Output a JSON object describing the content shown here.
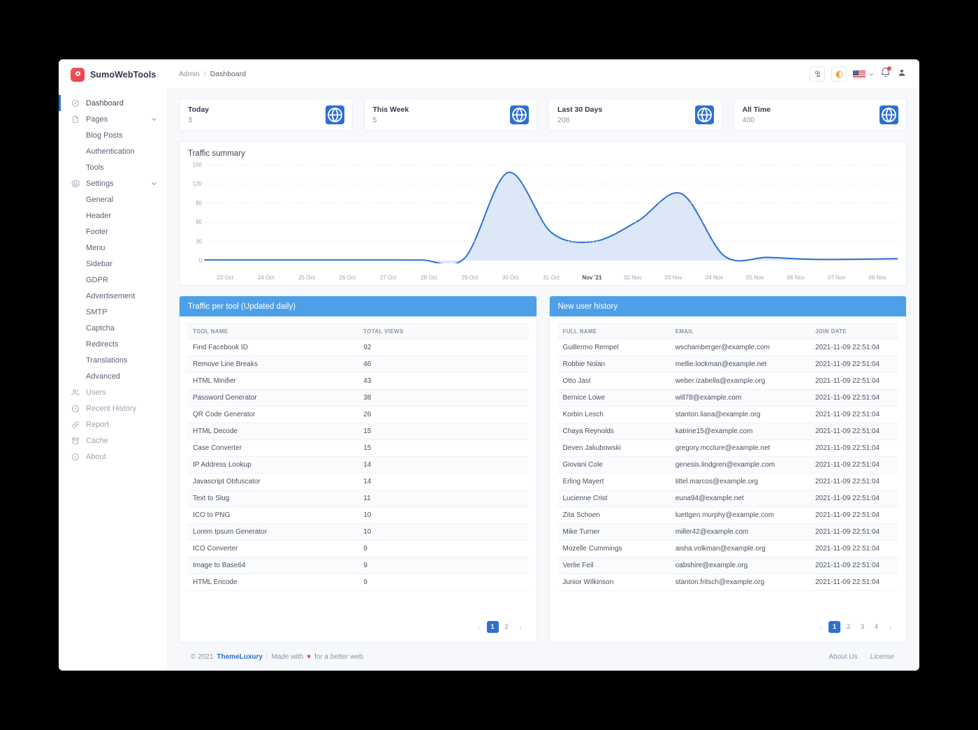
{
  "brand": {
    "name": "SumoWebTools",
    "logo_icon": "gear-flower-icon",
    "logo_color": "#ee4a55"
  },
  "sidebar": {
    "items": [
      {
        "label": "Dashboard",
        "icon": "speedometer-icon",
        "level": "top",
        "active": true,
        "muted": false,
        "expandable": false
      },
      {
        "label": "Pages",
        "icon": "file-icon",
        "level": "top",
        "active": false,
        "muted": false,
        "expandable": true
      },
      {
        "label": "Blog Posts",
        "icon": "",
        "level": "sub",
        "active": false,
        "muted": false,
        "expandable": false
      },
      {
        "label": "Authentication",
        "icon": "",
        "level": "sub",
        "active": false,
        "muted": false,
        "expandable": false
      },
      {
        "label": "Tools",
        "icon": "",
        "level": "sub",
        "active": false,
        "muted": false,
        "expandable": false
      },
      {
        "label": "Settings",
        "icon": "gear-icon",
        "level": "top",
        "active": false,
        "muted": false,
        "expandable": true
      },
      {
        "label": "General",
        "icon": "",
        "level": "sub",
        "active": false,
        "muted": false,
        "expandable": false
      },
      {
        "label": "Header",
        "icon": "",
        "level": "sub",
        "active": false,
        "muted": false,
        "expandable": false
      },
      {
        "label": "Footer",
        "icon": "",
        "level": "sub",
        "active": false,
        "muted": false,
        "expandable": false
      },
      {
        "label": "Menu",
        "icon": "",
        "level": "sub",
        "active": false,
        "muted": false,
        "expandable": false
      },
      {
        "label": "Sidebar",
        "icon": "",
        "level": "sub",
        "active": false,
        "muted": false,
        "expandable": false
      },
      {
        "label": "GDPR",
        "icon": "",
        "level": "sub",
        "active": false,
        "muted": false,
        "expandable": false
      },
      {
        "label": "Advertisement",
        "icon": "",
        "level": "sub",
        "active": false,
        "muted": false,
        "expandable": false
      },
      {
        "label": "SMTP",
        "icon": "",
        "level": "sub",
        "active": false,
        "muted": false,
        "expandable": false
      },
      {
        "label": "Captcha",
        "icon": "",
        "level": "sub",
        "active": false,
        "muted": false,
        "expandable": false
      },
      {
        "label": "Redirects",
        "icon": "",
        "level": "sub",
        "active": false,
        "muted": false,
        "expandable": false
      },
      {
        "label": "Translations",
        "icon": "",
        "level": "sub",
        "active": false,
        "muted": false,
        "expandable": false
      },
      {
        "label": "Advanced",
        "icon": "",
        "level": "sub",
        "active": false,
        "muted": false,
        "expandable": false
      },
      {
        "label": "Users",
        "icon": "users-icon",
        "level": "top",
        "active": false,
        "muted": true,
        "expandable": false
      },
      {
        "label": "Recent History",
        "icon": "clock-icon",
        "level": "top",
        "active": false,
        "muted": true,
        "expandable": false
      },
      {
        "label": "Report",
        "icon": "link-icon",
        "level": "top",
        "active": false,
        "muted": true,
        "expandable": false
      },
      {
        "label": "Cache",
        "icon": "archive-icon",
        "level": "top",
        "active": false,
        "muted": true,
        "expandable": false
      },
      {
        "label": "About",
        "icon": "info-icon",
        "level": "top",
        "active": false,
        "muted": true,
        "expandable": false
      }
    ]
  },
  "topbar": {
    "breadcrumb": {
      "root": "Admin",
      "separator": "/",
      "current": "Dashboard"
    },
    "actions": [
      {
        "name": "typography-button",
        "icon": "pilcrow-icon"
      },
      {
        "name": "dark-mode-button",
        "icon": "moon-icon"
      },
      {
        "name": "language-selector",
        "icon": "us-flag-icon"
      },
      {
        "name": "notifications-button",
        "icon": "bell-icon"
      },
      {
        "name": "account-button",
        "icon": "user-icon"
      }
    ]
  },
  "stats": [
    {
      "title": "Today",
      "value": "3",
      "icon": "globe-icon"
    },
    {
      "title": "This Week",
      "value": "5",
      "icon": "globe-icon"
    },
    {
      "title": "Last 30 Days",
      "value": "208",
      "icon": "globe-icon"
    },
    {
      "title": "All Time",
      "value": "400",
      "icon": "globe-icon"
    }
  ],
  "chart_data": {
    "type": "area",
    "title": "Traffic summary",
    "xlabel": "",
    "ylabel": "",
    "ylim": [
      0,
      150
    ],
    "yticks": [
      0,
      30,
      60,
      90,
      120,
      150
    ],
    "grid": true,
    "legend": "none",
    "line_color": "#2f6fd0",
    "fill_color": "#d6e4f7",
    "categories": [
      "23 Oct",
      "24 Oct",
      "25 Oct",
      "26 Oct",
      "27 Oct",
      "28 Oct",
      "29 Oct",
      "30 Oct",
      "31 Oct",
      "Nov '21",
      "02 Nov",
      "03 Nov",
      "04 Nov",
      "05 Nov",
      "06 Nov",
      "07 Nov",
      "08 Nov"
    ],
    "bold_tick": "Nov '21",
    "values": [
      1,
      1,
      1,
      1,
      1,
      1,
      4,
      138,
      44,
      30,
      62,
      105,
      7,
      5,
      2,
      2,
      3
    ]
  },
  "traffic_panel": {
    "title": "Traffic per tool (Updated daily)",
    "columns": [
      "TOOL NAME",
      "TOTAL VIEWS"
    ],
    "rows": [
      [
        "Find Facebook ID",
        "92"
      ],
      [
        "Remove Line Breaks",
        "46"
      ],
      [
        "HTML Minifier",
        "43"
      ],
      [
        "Password Generator",
        "38"
      ],
      [
        "QR Code Generator",
        "26"
      ],
      [
        "HTML Decode",
        "15"
      ],
      [
        "Case Converter",
        "15"
      ],
      [
        "IP Address Lookup",
        "14"
      ],
      [
        "Javascript Obfuscator",
        "14"
      ],
      [
        "Text to Slug",
        "11"
      ],
      [
        "ICO to PNG",
        "10"
      ],
      [
        "Lorem Ipsum Generator",
        "10"
      ],
      [
        "ICO Converter",
        "9"
      ],
      [
        "Image to Base64",
        "9"
      ],
      [
        "HTML Encode",
        "9"
      ]
    ],
    "pagination": {
      "prev": "‹",
      "next": "›",
      "pages": [
        "1",
        "2"
      ],
      "active": "1"
    }
  },
  "users_panel": {
    "title": "New user history",
    "columns": [
      "FULL NAME",
      "EMAIL",
      "JOIN DATE"
    ],
    "rows": [
      [
        "Guillermo Rempel",
        "wschamberger@example.com",
        "2021-11-09 22:51:04"
      ],
      [
        "Robbie Nolan",
        "mellie.lockman@example.net",
        "2021-11-09 22:51:04"
      ],
      [
        "Otto Jast",
        "weber.izabella@example.org",
        "2021-11-09 22:51:04"
      ],
      [
        "Bernice Lowe",
        "will78@example.com",
        "2021-11-09 22:51:04"
      ],
      [
        "Korbin Lesch",
        "stanton.liana@example.org",
        "2021-11-09 22:51:04"
      ],
      [
        "Chaya Reynolds",
        "katrine15@example.com",
        "2021-11-09 22:51:04"
      ],
      [
        "Deven Jakubowski",
        "gregory.mcclure@example.net",
        "2021-11-09 22:51:04"
      ],
      [
        "Giovani Cole",
        "genesis.lindgren@example.com",
        "2021-11-09 22:51:04"
      ],
      [
        "Erling Mayert",
        "littel.marcos@example.org",
        "2021-11-09 22:51:04"
      ],
      [
        "Lucienne Crist",
        "euna94@example.net",
        "2021-11-09 22:51:04"
      ],
      [
        "Zita Schoen",
        "luettgen.murphy@example.com",
        "2021-11-09 22:51:04"
      ],
      [
        "Mike Turner",
        "miller42@example.com",
        "2021-11-09 22:51:04"
      ],
      [
        "Mozelle Cummings",
        "aisha.volkman@example.org",
        "2021-11-09 22:51:04"
      ],
      [
        "Verlie Feil",
        "oabshire@example.org",
        "2021-11-09 22:51:04"
      ],
      [
        "Junior Wilkinson",
        "stanton.fritsch@example.org",
        "2021-11-09 22:51:04"
      ]
    ],
    "pagination": {
      "prev": "‹",
      "next": "›",
      "pages": [
        "1",
        "2",
        "3",
        "4"
      ],
      "active": "1"
    }
  },
  "footer": {
    "copyright": "© 2021",
    "company": "ThemeLuxury",
    "divider": "|",
    "made_with": "Made with",
    "heart": "♥",
    "tagline": "for a better web.",
    "links": [
      "About Us",
      "License"
    ]
  },
  "colors": {
    "accent": "#2f6fd0",
    "panel_header": "#4da0e8",
    "brand": "#ee4a55",
    "danger": "#ef4444"
  }
}
